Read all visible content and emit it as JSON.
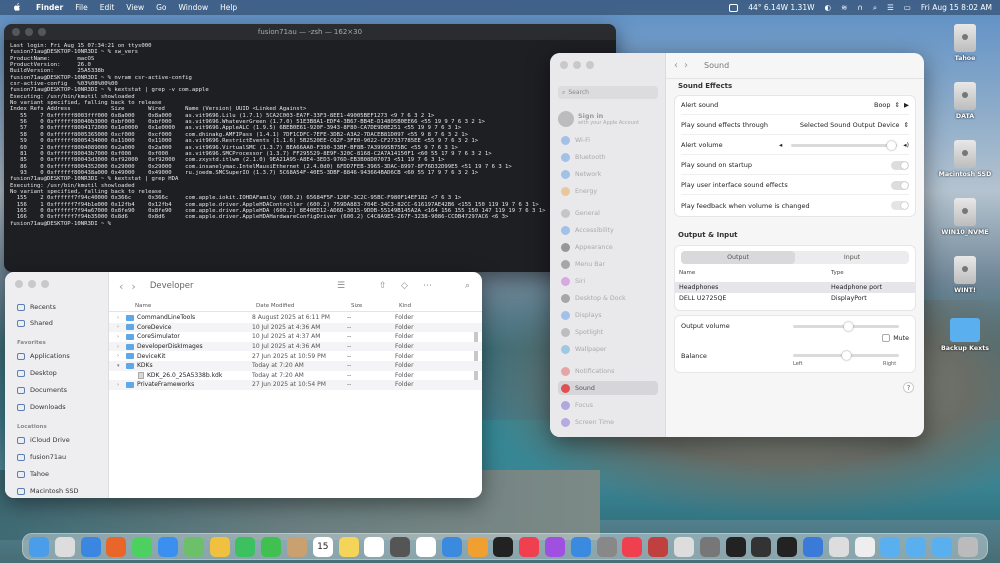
{
  "menubar": {
    "app": "Finder",
    "menus": [
      "File",
      "Edit",
      "View",
      "Go",
      "Window",
      "Help"
    ],
    "status": "44° 6.14W 1.31W",
    "clock": "Fri Aug 15  8:02 AM"
  },
  "terminal": {
    "title": "fusion71au — -zsh — 162×30",
    "lines": [
      "Last login: Fri Aug 15 07:34:21 on ttys000",
      "fusion71au@DESKTOP-10NR3DI ~ % sw_vers",
      "ProductName:        macOS",
      "ProductVersion:     26.0",
      "BuildVersion:       25A5338b",
      "fusion71au@DESKTOP-10NR3DI ~ % nvram csr-active-config",
      "csr-active-config   %03%08%00%00",
      "fusion71au@DESKTOP-10NR3DI ~ % kextstat | grep -v com.apple",
      "Executing: /usr/bin/kmutil showloaded",
      "No variant specified, falling back to release",
      "Index Refs Address            Size       Wired      Name (Version) UUID <Linked Against>",
      "   55    7 0xffffff8003fff000 0x8a000    0x8a000    as.vit9696.Lilu (1.7.1) 5CA2C003-EA7F-33F3-8EE1-49005BEF1273 <9 7 6 3 2 1>",
      "   56    0 0xffffff80040b3000 0xbf000    0xbf000    as.vit9696.WhateverGreen (1.7.0) 51E3B8A1-EDF4-3B67-BB4E-D14805B0EE66 <55 19 9 7 6 3 2 1>",
      "   57    0 0xffffff8004172000 0x1e0000   0x1e0000   as.vit9696.AppleALC (1.9.5) 6BEB0E61-920F-3943-8F80-CA7DE9D0E251 <55 19 9 7 6 3 1>",
      "   58    0 0xffffff8005365000 0xcf000    0xcf000    com.dhinakg.AMFIPass (1.4.1) 7DF1CDFC-7EFE-3DB2-A3A2-7DACEB81D097 <55 9 8 7 6 3 2 1>",
      "   59    0 0xffffff8005434000 0x11000    0x11000    as.vit9696.RestrictEvents (1.1.6) 5B2520EE-C62F-3FE0-9022-CF27337785EE <55 9 7 6 3 2 1>",
      "   60    2 0xffffff8004089000 0x2a000    0x2a000    as.vit9696.VirtualSMC (1.3.7) BEA66AA0-F390-33BF-BF8B-7A39995B75BC <55 9 7 6 3 1>",
      "   81    0 0xffffff80043b7000 0xf000     0xf000     as.vit9696.SMCProcessor (1.3.7) FF295529-8E9F-320C-8168-C2A7A14150F1 <60 55 17 9 7 6 3 2 1>",
      "   85    0 0xffffff80043d3000 0xf92000   0xf92000   com.zxystd.itlwm (2.1.0) 9EA21A95-A8E4-3ED3-976D-EB3B08D07073 <51 19 7 6 3 1>",
      "   86    0 0xffffff8004352000 0x29000    0x29000    com.insanelymac.IntelMausiEthernet (2.4.0d0) 6FDD7FEB-3965-3DAC-8997-8F76D32D99E5 <51 19 7 6 3 1>",
      "   93    0 0xffffff800438a000 0x49000    0x49000    ru.joedm.SMCSuperIO (1.3.7) 5C68A54F-40E5-3DBF-8846-943664BAD6CB <60 55 17 9 7 6 3 2 1>",
      "fusion71au@DESKTOP-10NR3DI ~ % kextstat | grep HDA",
      "Executing: /usr/bin/kmutil showloaded",
      "No variant specified, falling back to release",
      "  155    2 0xffffff7f94c40000 0x366c     0x366c     com.apple.iokit.IOHDAFamily (600.2) 65684F5F-126F-3C2C-95BC-F980F14EF182 <7 6 3 1>",
      "  156    1 0xffffff7f94b1e000 0x12fb4    0x12fb4    com.apple.driver.AppleHDAController (600.2) 759DA883-704E-34C3-82CC-616197AE42B6 <155 150 119 19 7 6 3 1>",
      "  165    0 0xffffff7f94a67000 0x8fe90    0x8fe90    com.apple.driver.AppleHDA (600.2) 8E40ED12-AD6D-3015-9DDB-55149B145A2A <164 156 155 150 147 119 19 7 6 3 1>",
      "  166    0 0xffffff7f94b35000 0x8d6      0x8d6      com.apple.driver.AppleHDAHardwareConfigDriver (600.2) C4C8A9E5-267F-3238-9086-CCDB47297AC6 <6 3>",
      "fusion71au@DESKTOP-10NR3DI ~ %"
    ]
  },
  "finder": {
    "title": "Developer",
    "sidebar": {
      "items_top": [
        "Recents",
        "Shared"
      ],
      "favorites_header": "Favorites",
      "favorites": [
        "Applications",
        "Desktop",
        "Documents",
        "Downloads"
      ],
      "locations_header": "Locations",
      "locations": [
        "iCloud Drive",
        "fusion71au",
        "Tahoe",
        "Macintosh SSD"
      ]
    },
    "columns": [
      "Name",
      "Date Modified",
      "Size",
      "Kind"
    ],
    "rows": [
      {
        "name": "CommandLineTools",
        "date": "8 August 2025 at 6:11 PM",
        "size": "--",
        "kind": "Folder"
      },
      {
        "name": "CoreDevice",
        "date": "10 Jul 2025 at 4:36 AM",
        "size": "--",
        "kind": "Folder"
      },
      {
        "name": "CoreSimulator",
        "date": "10 Jul 2025 at 4:37 AM",
        "size": "--",
        "kind": "Folder"
      },
      {
        "name": "DeveloperDiskImages",
        "date": "10 Jul 2025 at 4:36 AM",
        "size": "--",
        "kind": "Folder"
      },
      {
        "name": "DeviceKit",
        "date": "27 Jun 2025 at 10:59 PM",
        "size": "--",
        "kind": "Folder"
      },
      {
        "name": "KDKs",
        "date": "Today at 7:20 AM",
        "size": "--",
        "kind": "Folder"
      },
      {
        "name": "KDK_26.0_25A5338b.kdk",
        "date": "Today at 7:20 AM",
        "size": "--",
        "kind": "Folder"
      },
      {
        "name": "PrivateFrameworks",
        "date": "27 Jun 2025 at 10:54 PM",
        "size": "--",
        "kind": "Folder"
      }
    ]
  },
  "settings": {
    "title": "Sound",
    "search_placeholder": "Search",
    "signin_title": "Sign in",
    "signin_sub": "with your Apple Account",
    "nav": [
      "Wi-Fi",
      "Bluetooth",
      "Network",
      "Energy",
      "General",
      "Accessibility",
      "Appearance",
      "Menu Bar",
      "Siri",
      "Desktop & Dock",
      "Displays",
      "Spotlight",
      "Wallpaper",
      "Notifications",
      "Sound",
      "Focus",
      "Screen Time"
    ],
    "sound_effects_header": "Sound Effects",
    "alert_sound_label": "Alert sound",
    "alert_sound_value": "Boop",
    "play_through_label": "Play sound effects through",
    "play_through_value": "Selected Sound Output Device",
    "alert_volume_label": "Alert volume",
    "alert_volume_level": 0.95,
    "startup_label": "Play sound on startup",
    "ui_effects_label": "Play user interface sound effects",
    "feedback_label": "Play feedback when volume is changed",
    "io_header": "Output & Input",
    "tab_output": "Output",
    "tab_input": "Input",
    "col_name": "Name",
    "col_type": "Type",
    "devices": [
      {
        "name": "Headphones",
        "type": "Headphone port"
      },
      {
        "name": "DELL U2725QE",
        "type": "DisplayPort"
      }
    ],
    "output_volume_label": "Output volume",
    "output_volume_level": 0.52,
    "mute_label": "Mute",
    "balance_label": "Balance",
    "balance_left": "Left",
    "balance_right": "Right",
    "balance_level": 0.5,
    "help": "?"
  },
  "desktop": {
    "icons": [
      "Tahoe",
      "DATA",
      "Macintosh SSD",
      "WIN10_NVME",
      "WINT!",
      "Backup Kexts"
    ]
  },
  "dock": {
    "date_icon_day": "15"
  }
}
